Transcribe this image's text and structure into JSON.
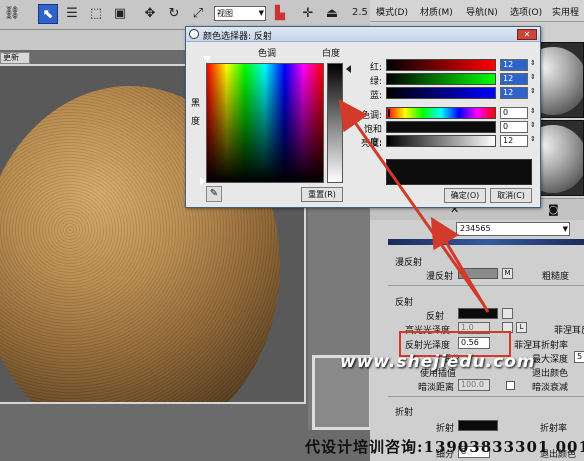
{
  "toolbar": {
    "view_select": "视图",
    "number": "2.5"
  },
  "menubar": {
    "items": [
      "模式(D)",
      "材质(M)",
      "导航(N)",
      "选项(O)",
      "实用程"
    ]
  },
  "viewport": {
    "tab_label": "更新"
  },
  "dialog": {
    "title": "颜色选择器: 反射",
    "close_label": "✕",
    "hue_header": "色调",
    "whiteness_header": "白度",
    "blackness_label": "黑度",
    "reset_label": "重置(R)",
    "ok_label": "确定(O)",
    "cancel_label": "取消(C)",
    "sliders": [
      {
        "label": "红:",
        "value": "12",
        "selected": true
      },
      {
        "label": "绿:",
        "value": "12",
        "selected": true
      },
      {
        "label": "蓝:",
        "value": "12",
        "selected": true
      },
      {
        "label": "色调:",
        "value": "0",
        "selected": false
      },
      {
        "label": "饱和度:",
        "value": "0",
        "selected": false
      },
      {
        "label": "亮度:",
        "value": "12",
        "selected": false
      }
    ]
  },
  "material": {
    "name": "234565",
    "diffuse_group": "漫反射",
    "diffuse_label": "漫反射",
    "diffuse_m": "M",
    "roughness_label": "粗糙度",
    "reflect_group": "反射",
    "reflect_label": "反射",
    "hilight_gloss_label": "高光光泽度",
    "hilight_gloss_value": "1.0",
    "l_button": "L",
    "fresnel_label": "菲涅耳反",
    "refl_gloss_label": "反射光泽度",
    "refl_gloss_value": "0.56",
    "fresnel_ior_label": "菲涅耳折射率",
    "subdivs_label": "细分",
    "max_depth_label": "最大深度",
    "max_depth_value": "5",
    "use_interp_label": "使用插值",
    "exit_color_label": "退出颜色",
    "dim_distance_label": "暗淡距离",
    "dim_distance_value": "100.0",
    "dim_falloff_label": "暗淡衰减",
    "refract_group": "折射",
    "refract_label": "折射",
    "refract_ior_label": "折射率",
    "refract_subdivs_label": "细分",
    "refract_subdivs_value": "8",
    "refract_exit_label": "退出颜色"
  },
  "watermark": "www.shejiedu.com",
  "footer": "代设计培训咨询:13903833301 00158",
  "colors": {
    "reflect_swatch": "#0c0c0c",
    "diffuse_swatch": "#8a8a8a",
    "highlight_blue": "#2d64c8",
    "annotation_red": "#d23a2a"
  }
}
